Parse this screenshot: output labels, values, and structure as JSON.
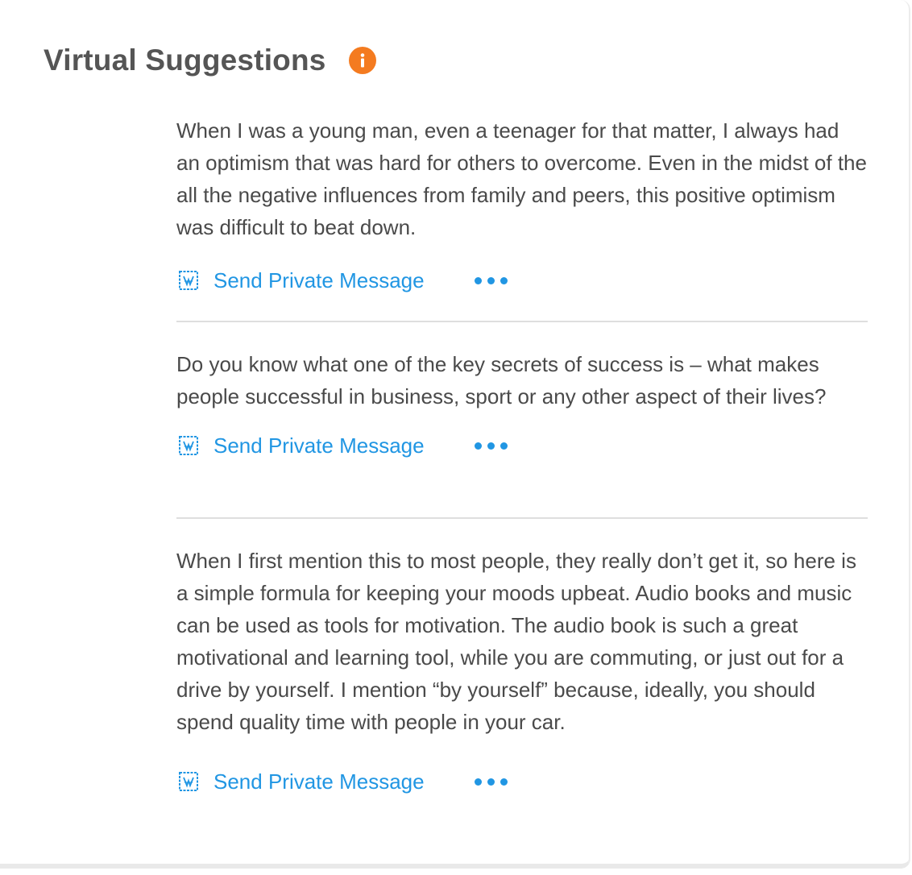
{
  "header": {
    "title": "Virtual Suggestions",
    "info_icon": "info-icon"
  },
  "colors": {
    "accent": "#2196e3",
    "info_badge": "#f47b20",
    "text": "#4a4a4a",
    "title": "#555555"
  },
  "suggestions": [
    {
      "text": "When I was a young man, even a teenager for that matter, I always had an optimism that was hard for others to overcome. Even in the midst of the all the negative influences from family and peers, this positive optimism was difficult to beat down.",
      "action_label": "Send Private Message",
      "action_icon": "private-message-icon",
      "more_icon": "more-icon"
    },
    {
      "text": "Do you know what one of the key secrets of success is – what makes people successful in business, sport or any other aspect of their lives?",
      "action_label": "Send Private Message",
      "action_icon": "private-message-icon",
      "more_icon": "more-icon"
    },
    {
      "text": "When I first mention this to most people, they really don’t get it, so here is a simple formula for keeping your moods upbeat. Audio books and music can be used as tools for motivation. The audio book is such a great motivational and learning tool, while you are commuting, or just out for a drive by yourself. I mention “by yourself” because, ideally, you should spend quality time with people in your car.",
      "action_label": "Send Private Message",
      "action_icon": "private-message-icon",
      "more_icon": "more-icon"
    }
  ]
}
